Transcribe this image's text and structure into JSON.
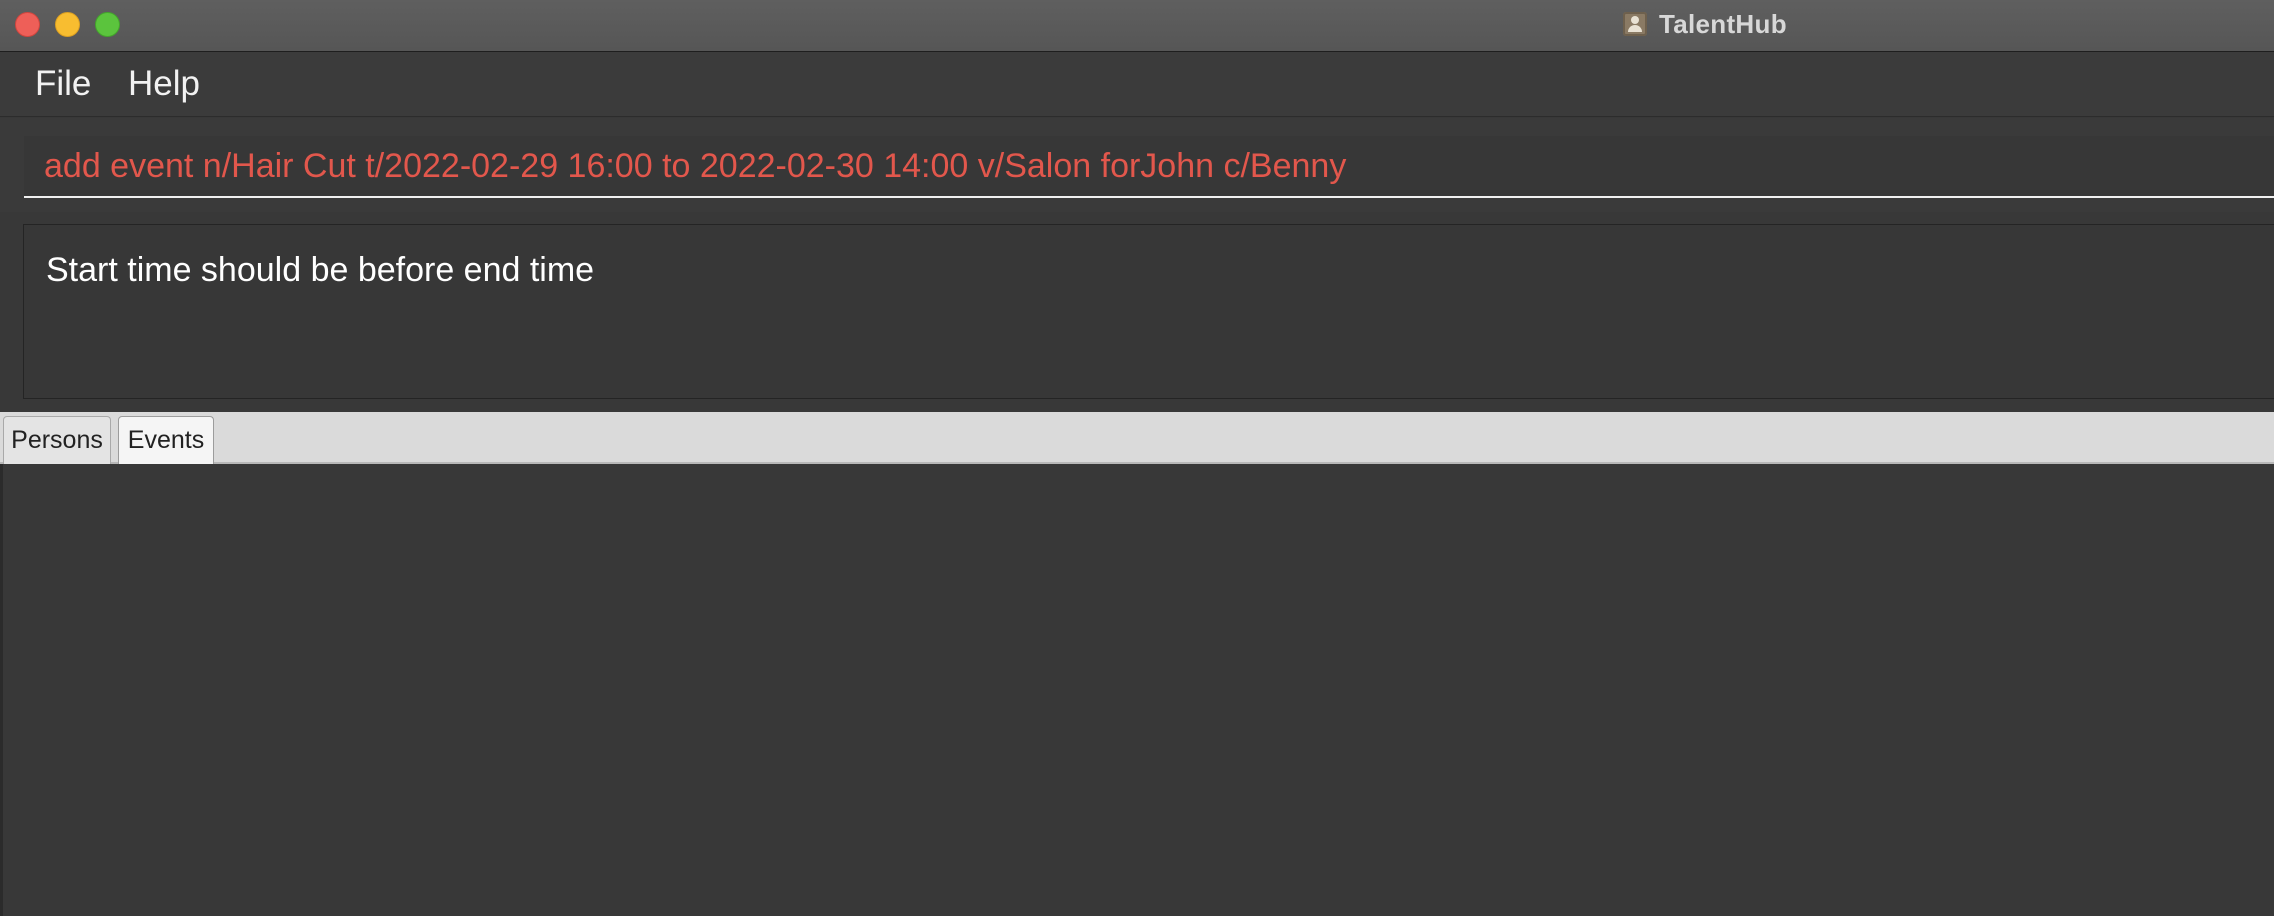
{
  "window": {
    "title": "TalentHub",
    "app_icon": "person-portrait-icon",
    "buttons": [
      "close",
      "minimize",
      "maximize"
    ]
  },
  "menubar": {
    "items": [
      {
        "label": "File"
      },
      {
        "label": "Help"
      }
    ]
  },
  "command_box": {
    "value": "add event n/Hair Cut t/2022-02-29 16:00 to 2022-02-30 14:00 v/Salon forJohn c/Benny",
    "text_color": "#e2574c"
  },
  "result_display": {
    "message": "Start time should be before end time"
  },
  "tabs": {
    "items": [
      {
        "label": "Persons",
        "selected": false
      },
      {
        "label": "Events",
        "selected": true
      }
    ]
  },
  "colors": {
    "background": "#383838",
    "error_text": "#e2574c",
    "traffic_close": "#ee5f58",
    "traffic_minimize": "#f8bd30",
    "traffic_maximize": "#5bc43d"
  }
}
